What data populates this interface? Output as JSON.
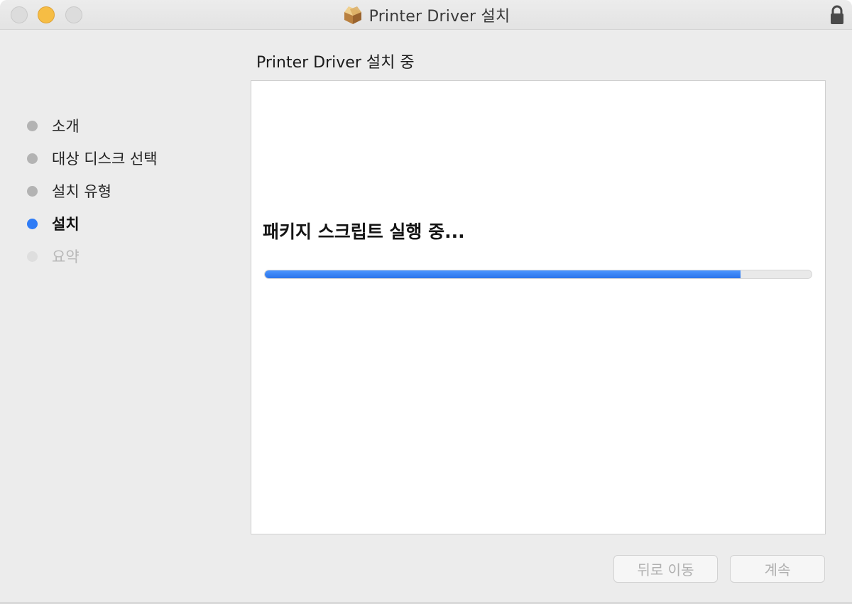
{
  "window": {
    "title": "Printer Driver 설치"
  },
  "sidebar": {
    "steps": [
      {
        "label": "소개",
        "state": "done"
      },
      {
        "label": "대상 디스크 선택",
        "state": "done"
      },
      {
        "label": "설치 유형",
        "state": "done"
      },
      {
        "label": "설치",
        "state": "active"
      },
      {
        "label": "요약",
        "state": "pending"
      }
    ]
  },
  "main": {
    "heading": "Printer Driver 설치 중",
    "status": "패키지 스크립트 실행 중...",
    "progress_fraction": 0.87
  },
  "buttons": {
    "back_label": "뒤로 이동",
    "continue_label": "계속"
  },
  "colors": {
    "accent": "#2f7cf6",
    "minimize": "#f6bd44"
  },
  "icons": {
    "title_icon": "package-icon",
    "lock": "lock-icon"
  }
}
